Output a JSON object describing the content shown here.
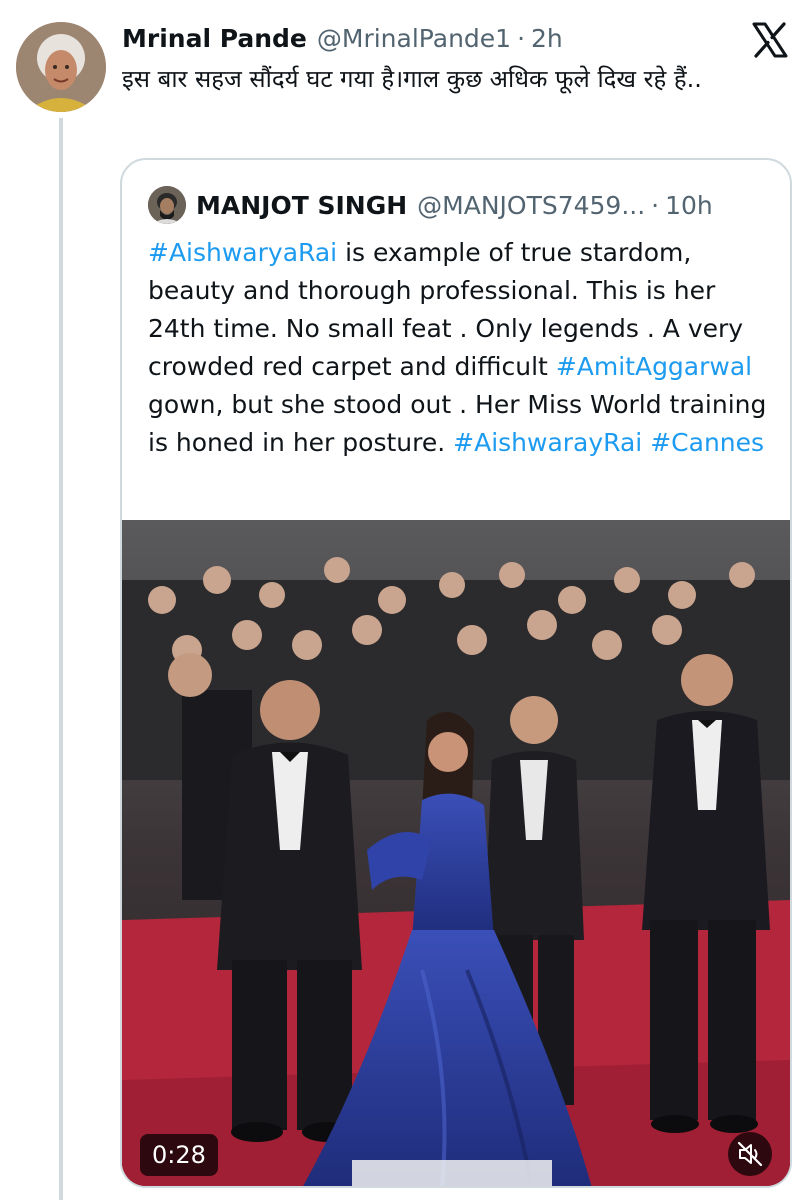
{
  "tweet": {
    "author_name": "Mrinal Pande",
    "author_handle": "@MrinalPande1",
    "separator": "·",
    "time": "2h",
    "text": "इस बार सहज सौंदर्य घट गया है।गाल कुछ अधिक फूले दिख रहे हैं..",
    "platform_icon": "x-logo-icon"
  },
  "quote": {
    "author_name": "MANJOT SINGH",
    "author_handle": "@MANJOTS7459...",
    "separator": "·",
    "time": "10h",
    "text_parts": {
      "tag1": "#AishwaryaRai",
      "p1": " is example of true stardom, beauty and thorough professional. This is her 24th time. No small feat . Only legends . A very crowded red carpet and difficult ",
      "tag2": "#AmitAggarwal",
      "p2": " gown, but she stood out . Her Miss World training is honed in her posture. ",
      "tag3": "#AishwarayRai",
      "p3": " ",
      "tag4": "#Cannes"
    },
    "video": {
      "duration": "0:28",
      "mute_icon": "muted-speaker-icon"
    }
  },
  "colors": {
    "link": "#1d9bf0",
    "secondary_text": "#536471",
    "border": "#cfd9de",
    "carpet": "#b3263b",
    "gown": "#2d3f9e"
  }
}
